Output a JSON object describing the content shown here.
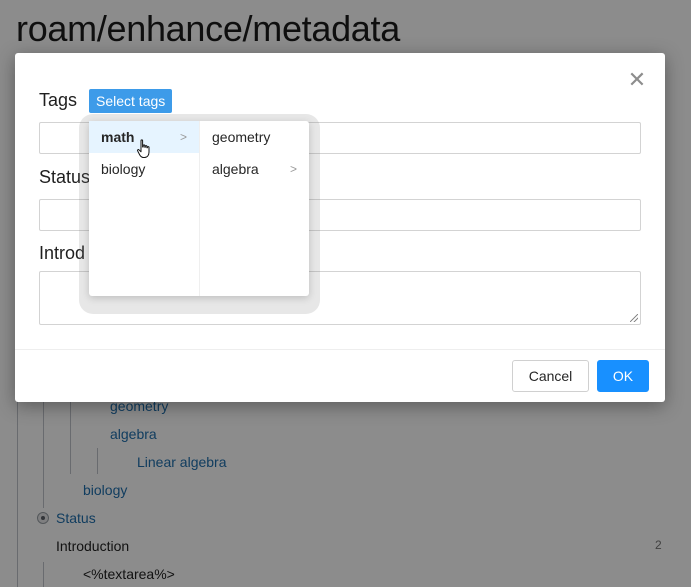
{
  "page": {
    "title": "roam/enhance/metadata",
    "outline": {
      "geometry": "geometry",
      "algebra": "algebra",
      "linear_algebra": "Linear algebra",
      "biology": "biology",
      "status": "Status",
      "introduction": "Introduction",
      "introduction_count": "2",
      "textarea_template": "<%textarea%>"
    }
  },
  "dialog": {
    "close_icon": "close-icon",
    "fields": {
      "tags_label": "Tags",
      "select_tags_button": "Select tags",
      "status_label": "Status",
      "introduction_label": "Introd"
    },
    "cascader": {
      "first_column": [
        {
          "label": "math",
          "has_children": true,
          "active": true
        },
        {
          "label": "biology",
          "has_children": false,
          "active": false
        }
      ],
      "second_column": [
        {
          "label": "geometry",
          "has_children": false
        },
        {
          "label": "algebra",
          "has_children": true
        }
      ],
      "arrow_glyph": ">"
    },
    "footer": {
      "cancel_label": "Cancel",
      "ok_label": "OK"
    }
  },
  "colors": {
    "primary": "#1890ff",
    "select_tags_bg": "#3d9be9",
    "link": "#1f6fae",
    "active_item_bg": "#e6f4ff"
  },
  "cursor": "hand-pointer-icon"
}
